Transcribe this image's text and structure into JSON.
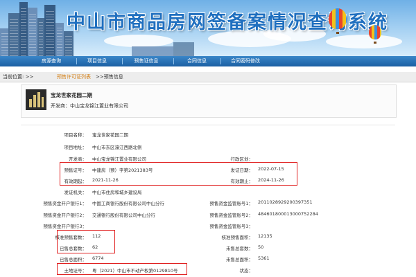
{
  "header": {
    "title": "中山市商品房网签备案情况查询系统"
  },
  "nav": [
    "房源查询",
    "项目信息",
    "预售证信息",
    "合同信息",
    "合同密码修改"
  ],
  "breadcrumb": {
    "prefix": "当前位置: >>",
    "link": "预售许可证列表",
    "current": ">>预售信息"
  },
  "project": {
    "name": "宝龙世家花园二期",
    "developer_line": "开发商：中山宝龙锦江置业有限公司"
  },
  "info": {
    "project_name": {
      "label": "项目名称：",
      "value": "宝龙世家花园二期"
    },
    "address": {
      "label": "项目地址：",
      "value": "中山市东区濠江西路北侧"
    },
    "developer": {
      "label": "开发商：",
      "value": "中山宝龙锦江置业有限公司"
    },
    "district": {
      "label": "行政区划：",
      "value": ""
    },
    "presale_no": {
      "label": "预售证号：",
      "value": "中建房（预）字第2021383号"
    },
    "issue_date": {
      "label": "发证日期：",
      "value": "2022-07-15"
    },
    "valid_from": {
      "label": "有效期起：",
      "value": "2021-11-26"
    },
    "valid_to": {
      "label": "有效期止：",
      "value": "2024-11-26"
    },
    "issuer": {
      "label": "发证机关：",
      "value": "中山市住房和城乡建设局"
    },
    "bank1": {
      "label": "预售资金开户银行1：",
      "value": "中国工商银行股份有限公司中山分行"
    },
    "acct1": {
      "label": "预售资金监管账号1：",
      "value": "2011028929200397351"
    },
    "bank2": {
      "label": "预售资金开户银行2：",
      "value": "交通银行股份有限公司中山分行"
    },
    "acct2": {
      "label": "预售资金监管账号2：",
      "value": "484601800013000752284"
    },
    "bank3": {
      "label": "预售资金开户银行3：",
      "value": ""
    },
    "acct3": {
      "label": "预售资金监管账号3：",
      "value": ""
    },
    "approved_sets": {
      "label": "核准预售套数：",
      "value": "112"
    },
    "approved_area": {
      "label": "核准预售面积：",
      "value": "12135"
    },
    "sold_sets": {
      "label": "已售总套数：",
      "value": "62"
    },
    "unsold_sets": {
      "label": "未售总套数：",
      "value": "50"
    },
    "sold_area": {
      "label": "已售总面积：",
      "value": "6774"
    },
    "unsold_area": {
      "label": "未售总面积：",
      "value": "5361"
    },
    "land_cert": {
      "label": "土地证号：",
      "value": "粤（2021）中山市不动产权第0129810号"
    },
    "status": {
      "label": "状态：",
      "value": ""
    }
  },
  "colors": {
    "nav_blue": "#1b5fa3",
    "link_orange": "#d4821b",
    "highlight_red": "#e02020"
  }
}
